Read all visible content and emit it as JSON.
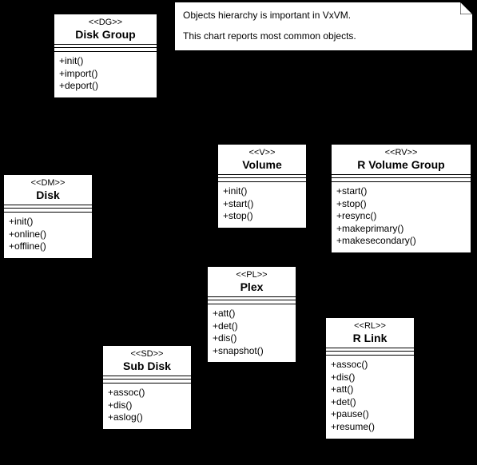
{
  "note": {
    "line1": "Objects hierarchy is important in VxVM.",
    "line2": "This chart reports most common objects."
  },
  "classes": {
    "diskgroup": {
      "stereo": "<<DG>>",
      "name": "Disk Group",
      "ops": "+init()\n+import()\n+deport()"
    },
    "disk": {
      "stereo": "<<DM>>",
      "name": "Disk",
      "ops": "+init()\n+online()\n+offline()"
    },
    "volume": {
      "stereo": "<<V>>",
      "name": "Volume",
      "ops": "+init()\n+start()\n+stop()"
    },
    "rvolumegroup": {
      "stereo": "<<RV>>",
      "name": "R Volume Group",
      "ops": "+start()\n+stop()\n+resync()\n+makeprimary()\n+makesecondary()"
    },
    "plex": {
      "stereo": "<<PL>>",
      "name": "Plex",
      "ops": "+att()\n+det()\n+dis()\n+snapshot()"
    },
    "subdisk": {
      "stereo": "<<SD>>",
      "name": "Sub Disk",
      "ops": "+assoc()\n+dis()\n+aslog()"
    },
    "rlink": {
      "stereo": "<<RL>>",
      "name": "R Link",
      "ops": "+assoc()\n+dis()\n+att()\n+det()\n+pause()\n+resume()"
    }
  }
}
